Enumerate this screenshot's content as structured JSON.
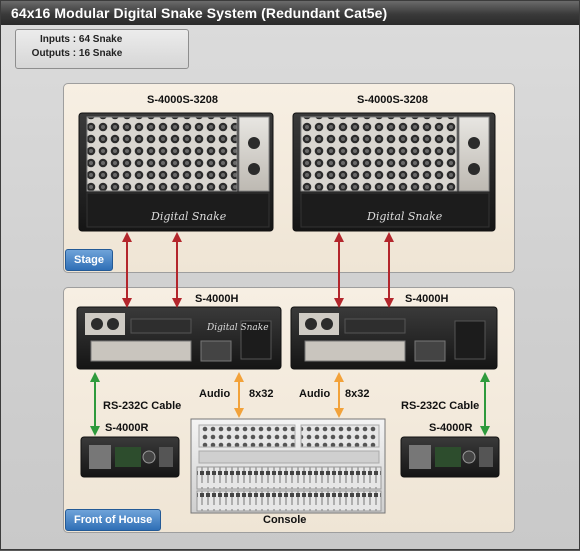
{
  "title": "64x16 Modular Digital Snake System (Redundant Cat5e)",
  "specs": {
    "inputs_label": "Inputs",
    "inputs_value": "64 Snake",
    "outputs_label": "Outputs",
    "outputs_value": "16 Snake"
  },
  "zones": {
    "stage": "Stage",
    "front_of_house": "Front of House"
  },
  "devices": {
    "stage_left": "S-4000S-3208",
    "stage_right": "S-4000S-3208",
    "foh_left": "S-4000H",
    "foh_right": "S-4000H",
    "remote_left": "S-4000R",
    "remote_right": "S-4000R",
    "console": "Console",
    "brand_marking": "Digital Snake"
  },
  "connections": {
    "audio_left_label": "Audio",
    "audio_left_count": "8x32",
    "audio_right_label": "Audio",
    "audio_right_count": "8x32",
    "serial_left": "RS-232C Cable",
    "serial_right": "RS-232C Cable"
  },
  "colors": {
    "cat5_link": "#b3262c",
    "serial_link": "#2e9a3c",
    "audio_link": "#f2a23a",
    "zone_tag": "#2f6fb6"
  }
}
